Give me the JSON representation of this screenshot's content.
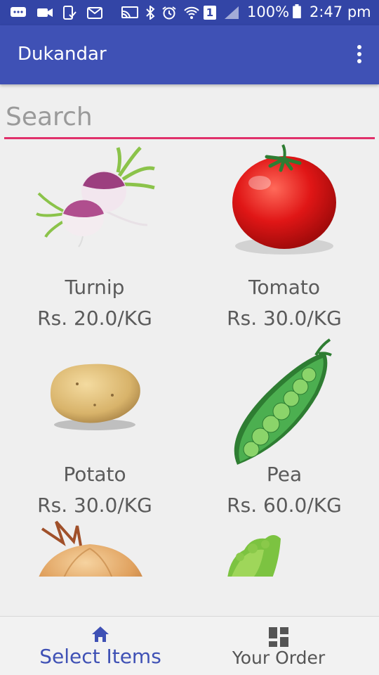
{
  "status_bar": {
    "battery": "100%",
    "time": "2:47 pm",
    "sim": "1"
  },
  "app_bar": {
    "title": "Dukandar",
    "overflow_icon": "more-vert-icon"
  },
  "search": {
    "placeholder": "Search",
    "value": ""
  },
  "products": [
    {
      "name": "Turnip",
      "price": "Rs. 20.0/KG"
    },
    {
      "name": "Tomato",
      "price": "Rs. 30.0/KG"
    },
    {
      "name": "Potato",
      "price": "Rs. 30.0/KG"
    },
    {
      "name": "Pea",
      "price": "Rs. 60.0/KG"
    },
    {
      "name": "",
      "price": ""
    },
    {
      "name": "",
      "price": ""
    }
  ],
  "bottom_nav": {
    "items": [
      {
        "label": "Select Items",
        "icon": "home-icon"
      },
      {
        "label": "Your Order",
        "icon": "dashboard-icon"
      }
    ]
  },
  "colors": {
    "primary": "#3f51b5",
    "primary_dark": "#3345a6",
    "accent": "#e0306a"
  }
}
